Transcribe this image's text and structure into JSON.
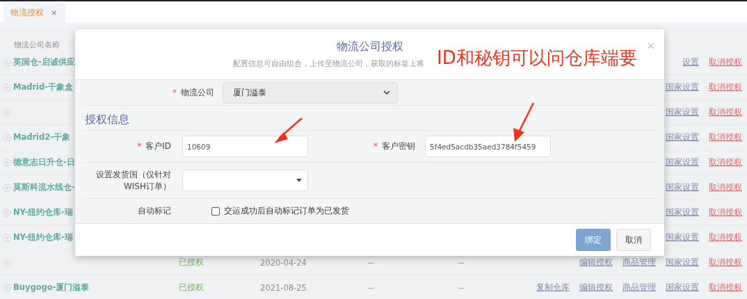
{
  "tabs": [
    {
      "label": "物流授权",
      "close": "×",
      "selected": true
    }
  ],
  "table": {
    "columns": [
      "物流公司名称"
    ],
    "rows": [
      {
        "name": "英国仓-启诚供应",
        "actions": [
          {
            "label": "设置",
            "kind": "link"
          },
          {
            "label": "取消授权",
            "kind": "danger"
          }
        ]
      },
      {
        "name": "Madrid-干象盒",
        "actions": [
          {
            "label": "国家设置",
            "kind": "link"
          },
          {
            "label": "取消授权",
            "kind": "danger"
          }
        ]
      },
      {
        "actions": [
          {
            "label": "国家设置",
            "kind": "link"
          },
          {
            "label": "取消授权",
            "kind": "danger"
          }
        ]
      },
      {
        "name": "Madrid2-干象",
        "actions": [
          {
            "label": "国家设置",
            "kind": "link"
          },
          {
            "label": "取消授权",
            "kind": "danger"
          }
        ]
      },
      {
        "name": "德意志日升仓-日",
        "actions": [
          {
            "label": "国家设置",
            "kind": "link"
          },
          {
            "label": "取消授权",
            "kind": "danger"
          }
        ]
      },
      {
        "name": "莫斯科流水线仓-",
        "actions": [
          {
            "label": "国家设置",
            "kind": "link"
          },
          {
            "label": "取消授权",
            "kind": "danger"
          }
        ]
      },
      {
        "name": "NY-纽约仓库-瑞",
        "actions": [
          {
            "label": "国家设置",
            "kind": "link"
          },
          {
            "label": "取消授权",
            "kind": "danger"
          }
        ]
      },
      {
        "name": "NY-纽约仓库-瑞",
        "actions": [
          {
            "label": "国家设置",
            "kind": "link"
          },
          {
            "label": "取消授权",
            "kind": "danger"
          }
        ]
      },
      {
        "status": "已授权",
        "date": "2020-04-24",
        "column_4": "--",
        "column_5": "--",
        "actions": [
          {
            "label": "编辑授权",
            "kind": "link"
          },
          {
            "label": "商品管理",
            "kind": "link"
          },
          {
            "label": "国家设置",
            "kind": "link"
          },
          {
            "label": "取消授权",
            "kind": "danger"
          }
        ]
      },
      {
        "name": "Buygogo-厦门溢泰",
        "status": "已授权",
        "date": "2021-08-25",
        "column_4": "--",
        "column_5": "--",
        "actions": [
          {
            "label": "复制仓库",
            "kind": "link"
          },
          {
            "label": "编辑授权",
            "kind": "link"
          },
          {
            "label": "商品管理",
            "kind": "link"
          },
          {
            "label": "国家设置",
            "kind": "link"
          },
          {
            "label": "取消授权",
            "kind": "danger"
          }
        ]
      }
    ]
  },
  "dialog": {
    "title": "物流公司授权",
    "subtitle": "配置信息可自由组合，上传至物流公司，获取的标签上将",
    "close": "×",
    "required_mark": "*",
    "carrier": {
      "label": "物流公司",
      "required": true,
      "value": "厦门溢泰",
      "disabled": true
    },
    "section": "授权信息",
    "credentials": [
      {
        "label": "客户ID",
        "required": true,
        "value": "10609"
      },
      {
        "label": "客户密钥",
        "required": true,
        "value": "5f4ed5acdb35aed3784f5459"
      }
    ],
    "ship_country": {
      "label": "设置发货国（仅针对WISH订单）",
      "required": false
    },
    "auto_mark": {
      "label": "自动标记",
      "option": "交运成功后自动标记订单为已发货",
      "checked": false
    },
    "buttons": [
      {
        "label": "绑定",
        "kind": "primary"
      },
      {
        "label": "取消",
        "kind": "default"
      }
    ]
  },
  "annotation": {
    "text": "ID和秘钥可以问仓库端要"
  }
}
